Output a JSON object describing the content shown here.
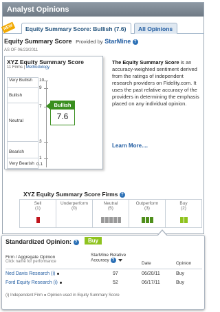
{
  "header": {
    "title": "Analyst Opinions"
  },
  "tabs": [
    {
      "label": "Equity Summary Score:  Bullish (7.6)",
      "new_badge": "NEW"
    },
    {
      "label": "All Opinions"
    }
  ],
  "summary": {
    "title": "Equity Summary Score",
    "provided_by": "Provided by",
    "provider": "StarMine",
    "as_of": "AS OF 06/23/2011"
  },
  "score_box": {
    "title": "XYZ  Equity Summary Score",
    "firms_count": "11 Firms",
    "methodology": "Methodology",
    "bands": [
      "Very Bullish",
      "Bullish",
      "Neutral",
      "Bearish",
      "Very Bearish"
    ],
    "ticks": [
      "10",
      "9",
      "7",
      "3",
      "1",
      "0.1"
    ],
    "rating": "Bullish",
    "score": "7.6"
  },
  "description": {
    "bold": "The Equity Summary Score",
    "text": " is an accuracy-weighted sentiment derived from the ratings of independent research providers on Fidelity.com. It uses the past relative accuracy of the providers in determining the emphasis placed on any individual opinion.",
    "learn_more": "Learn More...."
  },
  "firms": {
    "title": "XYZ  Equity Summary Score Firms",
    "columns": [
      {
        "label": "Sell",
        "count": "(1)",
        "bars": 1,
        "kind": "sell"
      },
      {
        "label": "Underperform",
        "count": "(0)",
        "bars": 0,
        "kind": "sell"
      },
      {
        "label": "Neutral",
        "count": "(5)",
        "bars": 5,
        "kind": "neutral"
      },
      {
        "label": "Outperform",
        "count": "(3)",
        "bars": 3,
        "kind": "outperform"
      },
      {
        "label": "Buy",
        "count": "(2)",
        "bars": 2,
        "kind": "buy"
      }
    ]
  },
  "standardized": {
    "title": "Standardized Opinion:",
    "value": "Buy",
    "headers": {
      "firm": "Firm / Aggregate Opinion",
      "firm_sub": "Click name for performance",
      "accuracy": "StarMine Relative Accuracy",
      "date": "Date",
      "opinion": "Opinion"
    },
    "rows": [
      {
        "firm": "Ned Davis Research (i)",
        "accuracy": "97",
        "date": "06/20/11",
        "opinion": "Buy"
      },
      {
        "firm": "Ford Equity Research (i)",
        "accuracy": "52",
        "date": "06/17/11",
        "opinion": "Buy"
      }
    ],
    "legend": "(i) Independent Firm     ● Opinion used in Equity Summary Score"
  },
  "colors": {
    "bullish": "#3a8f1f",
    "sell": "#c0141c",
    "neutral": "#9a9a9a",
    "outperform": "#4f8f1c",
    "buy": "#8fc31f",
    "link": "#1e5aa0"
  }
}
